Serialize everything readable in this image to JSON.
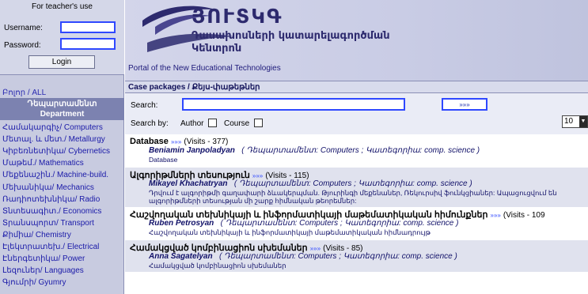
{
  "login": {
    "title": "For teacher's use",
    "username_label": "Username:",
    "username_value": "",
    "password_label": "Password:",
    "password_value": "",
    "login_label": "Login"
  },
  "sidebar": {
    "all_label": "Բոլոր / ALL",
    "department_header": "Դեպարտամենտ\nDepartment",
    "items": [
      "Համակարգիչ/ Computers",
      "Մետալ. և մետ./ Metallurgy",
      "Կիբեռնետիկա/ Cybernetics",
      "Մաթեմ./ Mathematics",
      "Մեքենաշին./ Machine-build.",
      "Մեխանիկա/ Mechanics",
      "Ռադիոտեխնիկա/ Radio",
      "Տնտեսագիտ./ Economics",
      "Տրանսպորտ/ Transport",
      "Քիմիա/ Chemistry",
      "Էլեկտրատեխ./ Electrical",
      "Էներգետիկա/ Power",
      "Լեզուներ/ Languages",
      "Գյումրի/ Gyumry"
    ]
  },
  "header": {
    "logo_title": "ՅՈՒՏԿԳ",
    "logo_sub1": "Դասախոսների կատարելագործման",
    "logo_sub2": "Կենտրոն",
    "portal_link": "Portal of the New Educational Technologies"
  },
  "breadcrumb": "Case packages / Քեյս-փաթեթներ",
  "search": {
    "label": "Search:",
    "value": "",
    "go_label": "»»»",
    "searchby_label": "Search by:",
    "author_label": "Author",
    "course_label": "Course",
    "page_size": "10"
  },
  "results": [
    {
      "title": "Database",
      "visits": "(Visits - 377)",
      "author": "Beniamin Janpoladyan",
      "meta": "( Դեպարտամենտ: Computers ;  Կատեգորիա: comp. science )",
      "desc": "Database"
    },
    {
      "title": "Ալգորիթմների տեսություն",
      "visits": "(Visits - 115)",
      "author": "Mikayel Khachatryan",
      "meta": "( Դեպարտամենտ: Computers ;  Կատեգորիա: comp. science )",
      "desc": "Դրվում է ալգորիթմի գաղափարի ձևակերպման. Թյուրինգի մեքենաներ, Ռեկուրսիվ ֆունկցիաներ: Ապացուցվում են",
      "desc2": "ալգորիթմների տեսության մի շարք հիմնական թեորեմներ:"
    },
    {
      "title": "Հաշվողական տեխնիկայի և ինֆորմատիկայի մաթեմատիկական հիմունքներ",
      "visits": "(Visits - 109",
      "author": "Ruben Petrosyan",
      "meta": "( Դեպարտամենտ: Computers ;  Կատեգորիա: comp. science )",
      "desc": "Հաշվողական տեխնիկայի և ինֆորմատիկայի մաթեմատիկական հիմնադրույթ"
    },
    {
      "title": "Համակցված կոմբինացիոն սխեմաներ",
      "visits": "(Visits - 85)",
      "author": "Anna Sagatelyan",
      "meta": "( Դեպարտամենտ: Computers ;  Կատեգորիա: comp. science )",
      "desc": "Համակցված կոմբինացիոն սխեմաներ"
    }
  ],
  "colors": {
    "input_border": "#2f48ff",
    "sidebar_bg": "#c8cbe0",
    "department_bg": "#7c82b0",
    "link": "#1a1aa8"
  }
}
